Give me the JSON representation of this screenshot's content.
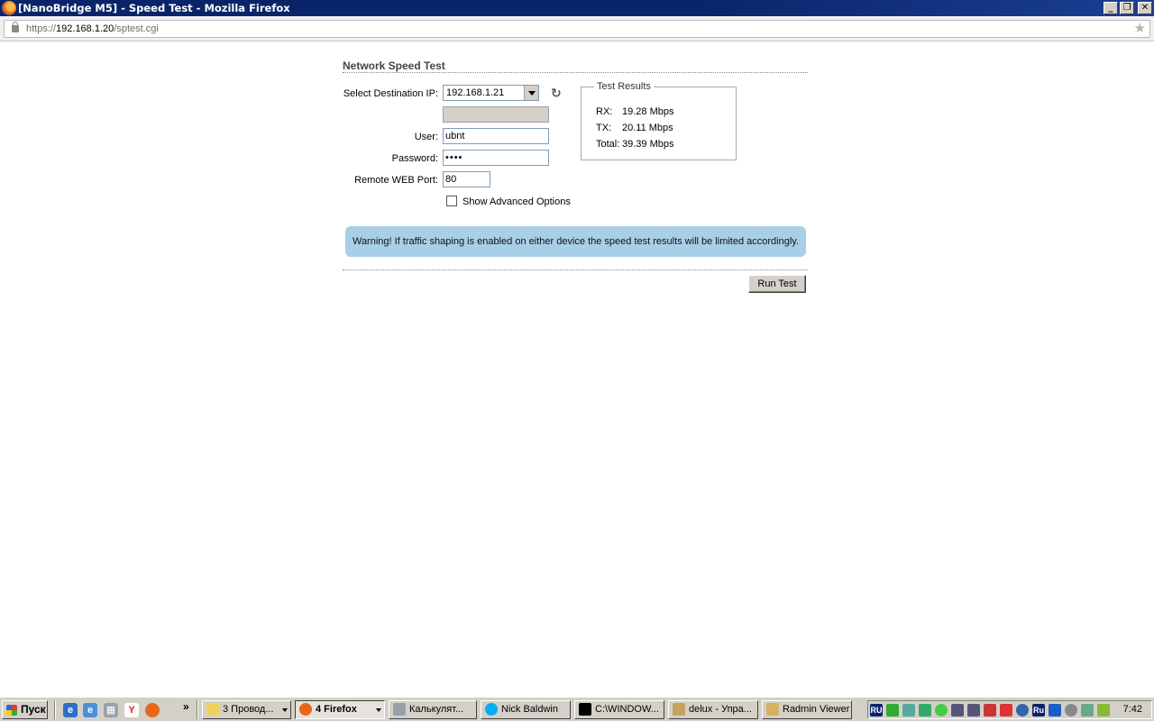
{
  "window": {
    "title": "[NanoBridge M5] - Speed Test - Mozilla Firefox",
    "buttons": {
      "minimize": "_",
      "maximize": "❐",
      "close": "✕"
    }
  },
  "urlbar": {
    "scheme": "https://",
    "host": "192.168.1.20",
    "path": "/sptest.cgi"
  },
  "page": {
    "title": "Network Speed Test",
    "form": {
      "dest_ip_label": "Select Destination IP:",
      "dest_ip_value": "192.168.1.21",
      "user_label": "User:",
      "user_value": "ubnt",
      "password_label": "Password:",
      "password_value": "••••",
      "port_label": "Remote WEB Port:",
      "port_value": "80",
      "advanced_label": "Show Advanced Options"
    },
    "results": {
      "legend": "Test Results",
      "rx_label": "RX:",
      "rx_value": "19.28 Mbps",
      "tx_label": "TX:",
      "tx_value": "20.11 Mbps",
      "total_label": "Total:",
      "total_value": "39.39 Mbps"
    },
    "warning": "Warning! If traffic shaping is enabled on either device the speed test results will be limited accordingly.",
    "run_button": "Run Test"
  },
  "taskbar": {
    "start_label": "Пуск",
    "chevron": "»",
    "tasks": [
      {
        "label": "3 Провод..."
      },
      {
        "label": "4 Firefox"
      },
      {
        "label": "Калькулят..."
      },
      {
        "label": "Nick Baldwin"
      },
      {
        "label": "C:\\WINDOW..."
      },
      {
        "label": "delux - Упра..."
      },
      {
        "label": "Radmin Viewer"
      }
    ],
    "tray": {
      "lang1": "RU",
      "lang2": "Ru",
      "clock": "7:42"
    }
  },
  "colors": {
    "titlebar": "#0a246a",
    "warning_bg": "#a8cfe8",
    "chrome": "#d4d0c8"
  }
}
